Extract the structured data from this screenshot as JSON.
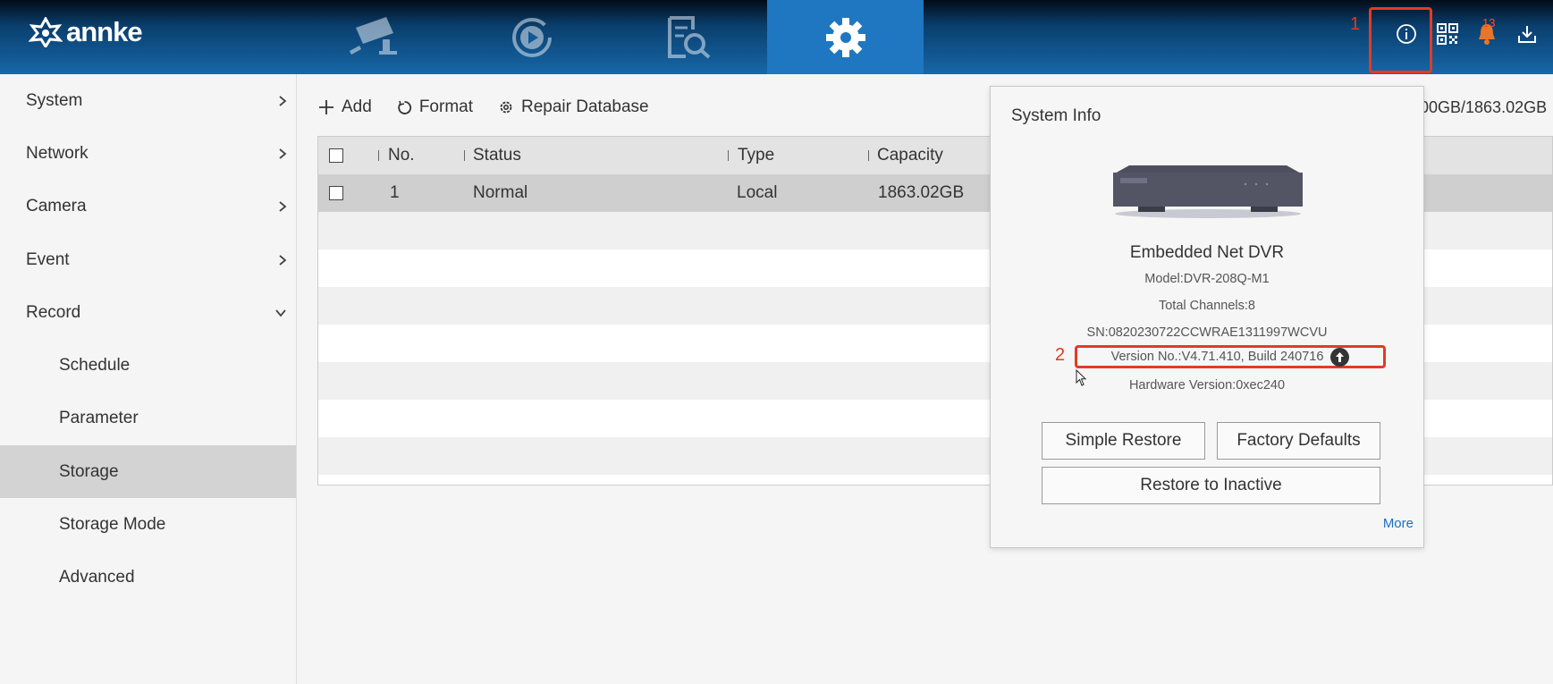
{
  "header": {
    "logo_text": "annke",
    "nav_tabs": [
      {
        "name": "live-view",
        "icon": "camera-icon",
        "active": false
      },
      {
        "name": "playback",
        "icon": "playback-icon",
        "active": false
      },
      {
        "name": "search",
        "icon": "file-search-icon",
        "active": false
      },
      {
        "name": "configuration",
        "icon": "gear-icon",
        "active": true
      }
    ],
    "right_icons": [
      "info-icon",
      "qr-code-icon",
      "bell-icon",
      "download-icon"
    ],
    "notification_count": "13",
    "annotation_1": "1",
    "accent_color": "#1e77c0"
  },
  "sidebar": {
    "items": [
      {
        "label": "System",
        "expanded": false
      },
      {
        "label": "Network",
        "expanded": false
      },
      {
        "label": "Camera",
        "expanded": false
      },
      {
        "label": "Event",
        "expanded": false
      },
      {
        "label": "Record",
        "expanded": true
      }
    ],
    "subitems": [
      {
        "label": "Schedule"
      },
      {
        "label": "Parameter"
      },
      {
        "label": "Storage",
        "active": true
      },
      {
        "label": "Storage Mode"
      },
      {
        "label": "Advanced"
      }
    ]
  },
  "toolbar": {
    "add_label": "Add",
    "format_label": "Format",
    "repair_label": "Repair Database",
    "capacity_summary": "00GB/1863.02GB"
  },
  "table": {
    "headers": {
      "no": "No.",
      "status": "Status",
      "type": "Type",
      "capacity": "Capacity"
    },
    "rows": [
      {
        "no": "1",
        "status": "Normal",
        "type": "Local",
        "capacity": "1863.02GB"
      }
    ]
  },
  "system_info": {
    "title": "System Info",
    "device_name": "Embedded Net DVR",
    "model": "Model:DVR-208Q-M1",
    "channels": "Total Channels:8",
    "serial": "SN:0820230722CCWRAE1311997WCVU",
    "version": "Version No.:V4.71.410, Build 240716",
    "hardware": "Hardware Version:0xec240",
    "simple_restore": "Simple Restore",
    "factory_defaults": "Factory Defaults",
    "restore_inactive": "Restore to Inactive",
    "more": "More",
    "annotation_2": "2",
    "highlight_color": "#e23c24"
  }
}
